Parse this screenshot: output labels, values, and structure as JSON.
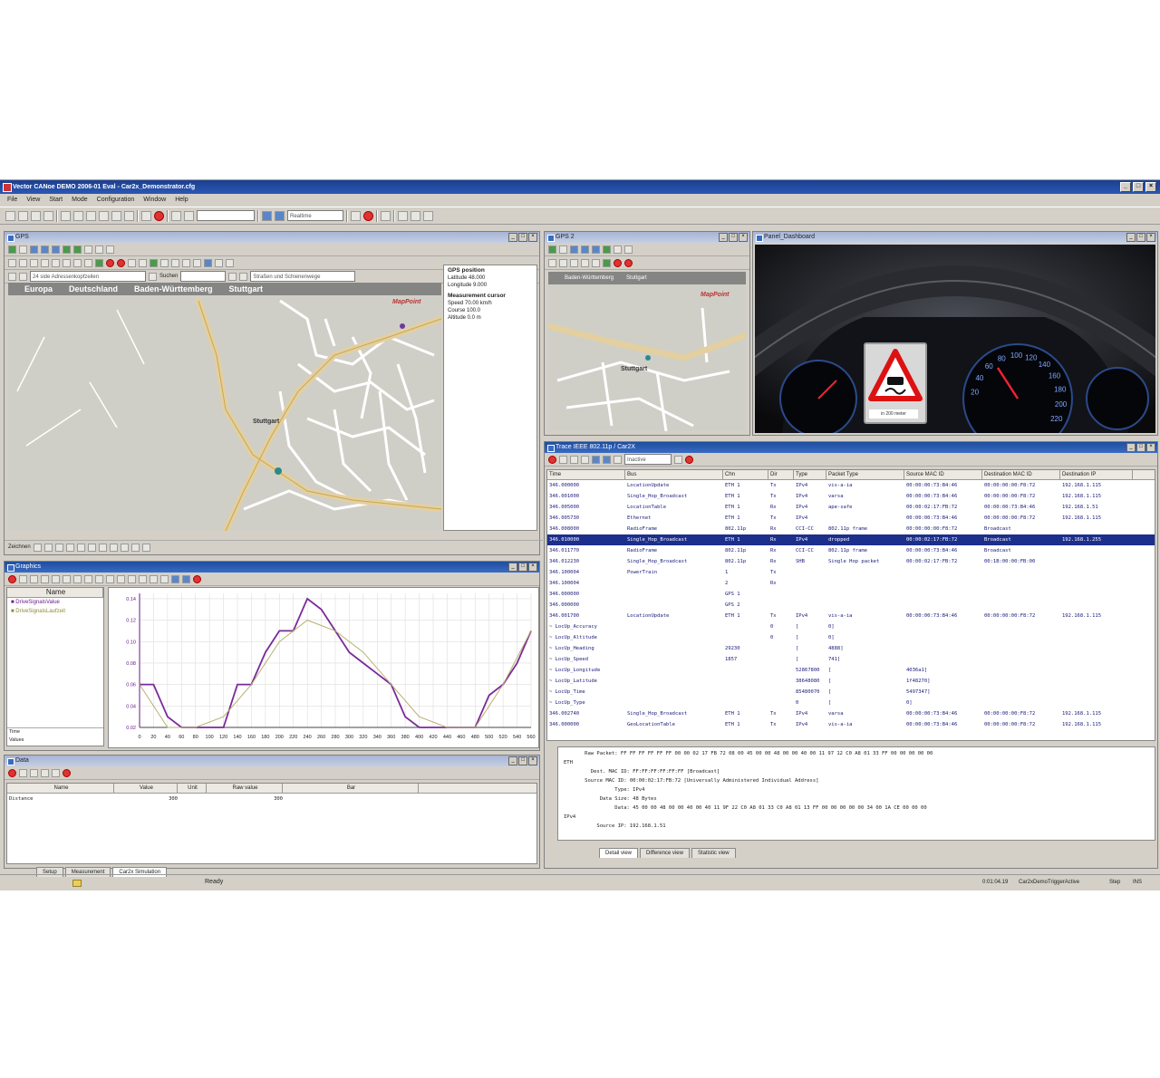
{
  "app": {
    "title": "Vector CANoe  DEMO 2006-01  Eval  - Car2x_Demonstrator.cfg"
  },
  "menu": [
    "File",
    "View",
    "Start",
    "Mode",
    "Configuration",
    "Window",
    "Help"
  ],
  "toolbar": {
    "combo1": "",
    "combo2": "Realtime"
  },
  "map_main": {
    "title": "GPS",
    "address_combo": "24 side Adressenkopfzeilen",
    "search_label": "Suchen",
    "layer_combo": "Straßen und Schienenwege",
    "breadcrumb": [
      "Europa",
      "Deutschland",
      "Baden-Württemberg",
      "Stuttgart"
    ],
    "labels": {
      "city": "Stuttgart",
      "logo": "MapPoint"
    },
    "drawing_label": "Zeichnen"
  },
  "gps_info": {
    "header": "GPS position",
    "latitude": "Latitude 48.000",
    "longitude": "Longitude 9.000",
    "measurement_header": "Measurement cursor",
    "speed": "Speed 70.00 km/h",
    "course": "Course 100.0",
    "altitude": "Altitude 0.0 m"
  },
  "map_small": {
    "title": "GPS 2",
    "breadcrumb": [
      "Baden-Württemberg",
      "Stuttgart"
    ],
    "labels": {
      "city": "Stuttgart",
      "logo": "MapPoint"
    }
  },
  "dashboard": {
    "title": "Panel_Dashboard",
    "sign_caption": "in 200 meter",
    "speed_ticks": [
      "20",
      "40",
      "60",
      "80",
      "100",
      "120",
      "140",
      "160",
      "180",
      "200",
      "220"
    ]
  },
  "graphics": {
    "title": "Graphics",
    "legend_header": "Name",
    "legend_items": [
      "DriveSignalsValue",
      "DriveSignalsLaufzeit"
    ],
    "side_label1": "Time",
    "side_label2": "Values"
  },
  "chart_data": {
    "type": "line",
    "series": [
      {
        "name": "DriveSignalsValue",
        "x": [
          0,
          20,
          40,
          60,
          80,
          100,
          120,
          140,
          160,
          180,
          200,
          220,
          240,
          260,
          280,
          300,
          320,
          340,
          360,
          380,
          400,
          420,
          440,
          460,
          480,
          500,
          520,
          540,
          560
        ],
        "values": [
          0.06,
          0.06,
          0.03,
          0.02,
          0.02,
          0.02,
          0.02,
          0.06,
          0.06,
          0.09,
          0.11,
          0.11,
          0.14,
          0.13,
          0.11,
          0.09,
          0.08,
          0.07,
          0.06,
          0.03,
          0.02,
          0.02,
          0.02,
          0.02,
          0.02,
          0.05,
          0.06,
          0.08,
          0.11
        ]
      },
      {
        "name": "DriveSignalsLaufzeit",
        "x": [
          0,
          40,
          80,
          120,
          160,
          200,
          240,
          280,
          320,
          360,
          400,
          440,
          480,
          520,
          560
        ],
        "values": [
          0.06,
          0.02,
          0.02,
          0.03,
          0.06,
          0.1,
          0.12,
          0.11,
          0.09,
          0.06,
          0.03,
          0.02,
          0.02,
          0.06,
          0.11
        ]
      }
    ],
    "y_ticks": [
      "0.02",
      "0.04",
      "0.06",
      "0.08",
      "0.10",
      "0.12",
      "0.14"
    ],
    "x_ticks": [
      "0",
      "20",
      "40",
      "60",
      "80",
      "100",
      "120",
      "140",
      "160",
      "180",
      "200",
      "220",
      "240",
      "260",
      "280",
      "300",
      "320",
      "340",
      "360",
      "380",
      "400",
      "420",
      "440",
      "460",
      "480",
      "500",
      "520",
      "540",
      "560"
    ],
    "ylim": [
      0.02,
      0.145
    ],
    "xlim": [
      0,
      560
    ]
  },
  "data_win": {
    "title": "Data",
    "columns": [
      "Name",
      "Value",
      "Unit",
      "Raw value",
      "Bar"
    ],
    "rows": [
      {
        "name": "Distance",
        "value": "300",
        "unit": "",
        "raw": "300",
        "bar": ""
      }
    ]
  },
  "trace": {
    "title": "Trace IEEE 802.11p / Car2X",
    "filter_combo": "Inactive",
    "columns": [
      "Time",
      "Bus",
      "Chn",
      "Dir",
      "Type",
      "Packet Type",
      "Source MAC ID",
      "Destination MAC ID",
      "Destination IP"
    ],
    "rows": [
      [
        "346.000000",
        "LocationUpdate",
        "ETH 1",
        "Tx",
        "IPv4",
        "vis-a-ia",
        "00:00:00:73:B4:46",
        "00:00:00:00:F8:72",
        "192.168.1.115"
      ],
      [
        "346.001000",
        "Single_Hop_Broadcast",
        "ETH 1",
        "Tx",
        "IPv4",
        "varsa",
        "00:00:00:73:B4:46",
        "00:00:00:00:F8:72",
        "192.168.1.115"
      ],
      [
        "346.005000",
        "LocationTable",
        "ETH 1",
        "Rx",
        "IPv4",
        "ape-safe",
        "00:00:02:17:FB:72",
        "00:00:00:73:B4:46",
        "192.168.1.51"
      ],
      [
        "346.005730",
        "Ethernet",
        "ETH 1",
        "Tx",
        "IPv4",
        "",
        "00:00:00:73:B4:46",
        "00:00:00:00:F8:72",
        "192.168.1.115"
      ],
      [
        "346.008000",
        "RadioFrame",
        "802.11p",
        "Rx",
        "CCI-CC",
        "802.11p frame",
        "00:00:00:00:F8:72",
        "Broadcast",
        ""
      ],
      [
        "346.010000",
        "Single_Hop_Broadcast",
        "ETH 1",
        "Rx",
        "IPv4",
        "dropped",
        "00:00:02:17:FB:72",
        "Broadcast",
        "192.168.1.255"
      ],
      [
        "346.011770",
        "RadioFrame",
        "802.11p",
        "Rx",
        "CCI-CC",
        "802.11p frame",
        "00:00:00:73:B4:46",
        "Broadcast",
        ""
      ],
      [
        "346.012230",
        "Single_Hop_Broadcast",
        "802.11p",
        "Rx",
        "SHB",
        "Single Hop packet",
        "00:00:02:17:FB:72",
        "00:1B:00:00:FB:00",
        ""
      ],
      [
        "346.100004",
        "PowerTrain",
        "1",
        "Tx",
        "",
        "",
        "",
        "",
        ""
      ],
      [
        "346.100004",
        "",
        "2",
        "Rx",
        "",
        "",
        "",
        "",
        ""
      ],
      [
        "346.000000",
        "",
        "GPS 1",
        "",
        "",
        "",
        "",
        "",
        ""
      ],
      [
        "346.000000",
        "",
        "GPS 2",
        "",
        "",
        "",
        "",
        "",
        ""
      ],
      [
        "346.001700",
        "LocationUpdate",
        "ETH 1",
        "Tx",
        "IPv4",
        "vis-a-ia",
        "00:00:00:73:B4:46",
        "00:00:00:00:F8:72",
        "192.168.1.115"
      ],
      [
        "~ LocUp_Accuracy",
        "",
        "",
        "0",
        "[",
        "0]",
        "",
        "",
        ""
      ],
      [
        "~ LocUp_Altitude",
        "",
        "",
        "0",
        "[",
        "0]",
        "",
        "",
        ""
      ],
      [
        "~ LocUp_Heading",
        "",
        "29230",
        "",
        "[",
        "4888]",
        "",
        "",
        ""
      ],
      [
        "~ LocUp_Speed",
        "",
        "1857",
        "",
        "[",
        "741]",
        "",
        "",
        ""
      ],
      [
        "~ LocUp_Longitude",
        "",
        "",
        "",
        "52867800",
        "[",
        "4036a1]",
        "",
        ""
      ],
      [
        "~ LocUp_Latitude",
        "",
        "",
        "",
        "38648080",
        "[",
        "1f48270]",
        "",
        ""
      ],
      [
        "~ LocUp_Time",
        "",
        "",
        "",
        "85480070",
        "[",
        "5497347]",
        "",
        ""
      ],
      [
        "~ LocUp_Type",
        "",
        "",
        "",
        "0",
        "[",
        "0]",
        "",
        ""
      ],
      [
        "346.002740",
        "Single_Hop_Broadcast",
        "ETH 1",
        "Tx",
        "IPv4",
        "varsa",
        "00:00:00:73:B4:46",
        "00:00:00:00:F8:72",
        "192.168.1.115"
      ],
      [
        "346.000000",
        "GeoLocationTable",
        "ETH 1",
        "Tx",
        "IPv4",
        "vis-a-ia",
        "00:00:00:73:B4:46",
        "00:00:00:00:F8:72",
        "192.168.1.115"
      ]
    ],
    "detail_lines": [
      "       Raw Packet: FF FF FF FF FF FF 00 00 02 17 FB 72 08 00 45 00 00 48 00 00 40 00 11 97 12 C0 A8 01 33 FF 00 00 00 00 00",
      "ETH",
      "         Dest. MAC ID: FF:FF:FF:FF:FF:FF [Broadcast]",
      "       Source MAC ID: 00:00:02:17:FB:72 [Universally Administered Individual Address]",
      "                 Type: IPv4",
      "            Data Size: 48 Bytes",
      "                 Data: 45 00 00 48 00 00 40 00 40 11 9F 22 C0 A8 01 33 C0 A8 01 13 FF 00 00 00 00 00 34 00 1A CE 00 00 00",
      "IPv4",
      "           Source IP: 192.168.1.51"
    ],
    "detail_tabs": [
      "Detail view",
      "Difference view",
      "Statistic view"
    ]
  },
  "bottom_tabs": [
    "Setup",
    "Measurement",
    "Car2x Simulation"
  ],
  "status": {
    "text": "Ready",
    "right1": "0:01:04.19",
    "right2": "Car2xDemoTriggerActive",
    "right3": "Step",
    "right4": "INS"
  }
}
